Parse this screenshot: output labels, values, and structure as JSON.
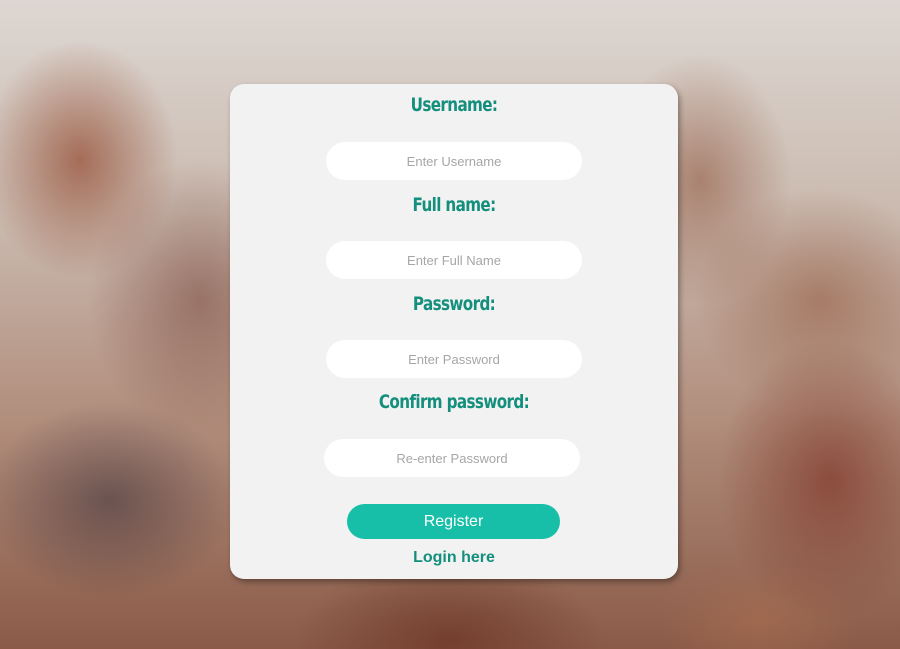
{
  "form": {
    "username_label": "Username:",
    "username_placeholder": "Enter Username",
    "fullname_label": "Full name:",
    "fullname_placeholder": "Enter Full Name",
    "password_label": "Password:",
    "password_placeholder": "Enter Password",
    "confirm_label": "Confirm password:",
    "confirm_placeholder": "Re-enter Password",
    "register_label": "Register",
    "login_link": "Login here"
  },
  "colors": {
    "accent": "#148f7d",
    "button": "#17bfa9",
    "card": "#f2f2f2"
  }
}
